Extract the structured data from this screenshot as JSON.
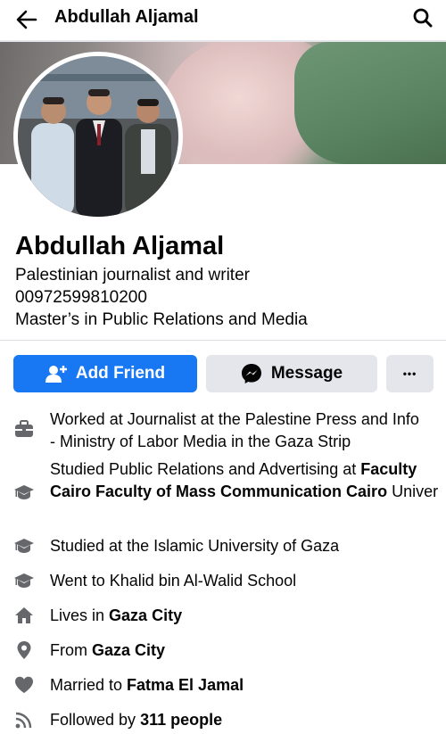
{
  "header": {
    "title": "Abdullah Aljamal"
  },
  "profile": {
    "name": "Abdullah Aljamal",
    "bio_lines": [
      "Palestinian journalist and writer",
      "00972599810200",
      "Master’s in Public Relations and Media"
    ]
  },
  "actions": {
    "add_friend": "Add Friend",
    "message": "Message",
    "more": "•••"
  },
  "details": {
    "work_line1": "Worked at Journalist at the Palestine Press and Info",
    "work_line2": "- Ministry of Labor Media in the Gaza Strip",
    "study1_prefix": "Studied Public Relations and Advertising at ",
    "study1_bold1": "Faculty",
    "study1_bold2": "Cairo Faculty of Mass Communication Cairo",
    "study1_suffix": " Univer",
    "study2": "Studied at the Islamic University of Gaza",
    "study3": "Went to Khalid bin Al-Walid School",
    "lives_prefix": "Lives in ",
    "lives_place": "Gaza City",
    "from_prefix": "From ",
    "from_place": "Gaza City",
    "married_prefix": "Married to ",
    "married_name": "Fatma El Jamal",
    "followed_prefix": "Followed by ",
    "followed_count": "311 people"
  },
  "icons": {
    "back": "arrow-left-icon",
    "search": "search-icon",
    "add_friend": "person-plus-icon",
    "message": "messenger-icon",
    "work": "briefcase-icon",
    "education": "graduation-cap-icon",
    "home": "home-icon",
    "location": "location-pin-icon",
    "relationship": "heart-icon",
    "followers": "rss-icon"
  },
  "colors": {
    "primary": "#1877f2",
    "secondary_button": "#e4e6eb",
    "text": "#050505",
    "icon": "#65676b"
  }
}
